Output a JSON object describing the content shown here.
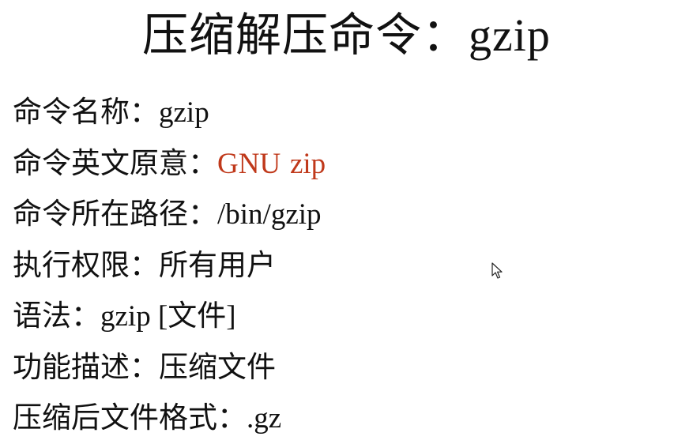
{
  "slide": {
    "title_cn": "压缩解压命令：",
    "title_cmd": "gzip",
    "rows": [
      {
        "label": "命令名称：",
        "value": "gzip"
      },
      {
        "label": "命令英文原意：",
        "value_part1": "GNU",
        "value_part2": "zip",
        "value_color": "#c0391b"
      },
      {
        "label": "命令所在路径：",
        "value": "/bin/gzip"
      },
      {
        "label": "执行权限：",
        "value": "所有用户"
      },
      {
        "label": "语法：",
        "value": "gzip [文件]"
      },
      {
        "label": "功能描述：",
        "value": "压缩文件"
      },
      {
        "label": "压缩后文件格式：",
        "value": ".gz"
      }
    ]
  },
  "icons": {
    "cursor": "mouse-pointer-icon"
  }
}
